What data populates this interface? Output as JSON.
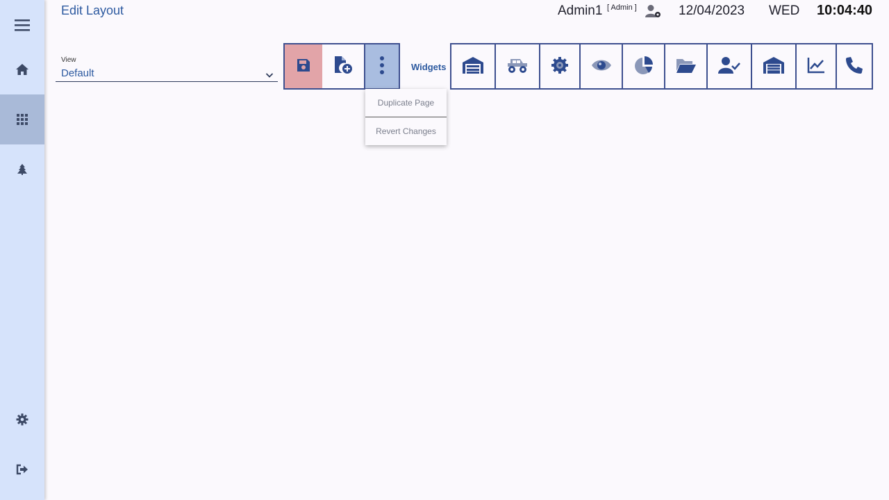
{
  "header": {
    "title": "Edit Layout",
    "user_name": "Admin1",
    "user_role": "[ Admin ]",
    "user_icon": "user-gear-icon",
    "date": "12/04/2023",
    "day": "WED",
    "time": "10:04:40"
  },
  "sidebar": {
    "items": [
      {
        "name": "menu",
        "icon": "hamburger-menu-icon"
      },
      {
        "name": "home",
        "icon": "home-icon"
      },
      {
        "name": "apps",
        "icon": "grid-icon",
        "active": true
      },
      {
        "name": "pine",
        "icon": "pine-tree-icon"
      },
      {
        "name": "settings",
        "icon": "gear-icon"
      },
      {
        "name": "logout",
        "icon": "logout-icon"
      }
    ]
  },
  "view": {
    "label": "View",
    "value": "Default"
  },
  "toolbar": {
    "save_icon": "floppy-disk-icon",
    "new_page_icon": "file-add-icon",
    "more_icon": "vertical-dots-icon",
    "widgets_label": "Widgets"
  },
  "widgets": [
    {
      "icon": "warehouse-icon"
    },
    {
      "icon": "monster-truck-icon"
    },
    {
      "icon": "cog-wheel-icon"
    },
    {
      "icon": "eye-icon"
    },
    {
      "icon": "pie-chart-icon"
    },
    {
      "icon": "folder-open-icon"
    },
    {
      "icon": "user-check-icon"
    },
    {
      "icon": "garage-icon"
    },
    {
      "icon": "line-chart-icon"
    },
    {
      "icon": "phone-icon"
    }
  ],
  "menu": {
    "items": [
      "Duplicate Page",
      "Revert Changes"
    ]
  },
  "colors": {
    "accent": "#2d5aa0",
    "sidebar_bg": "#d6e3fb",
    "save_bg": "#e2a4a8",
    "more_bg": "#a9bde0",
    "border": "#3d4f8f"
  }
}
